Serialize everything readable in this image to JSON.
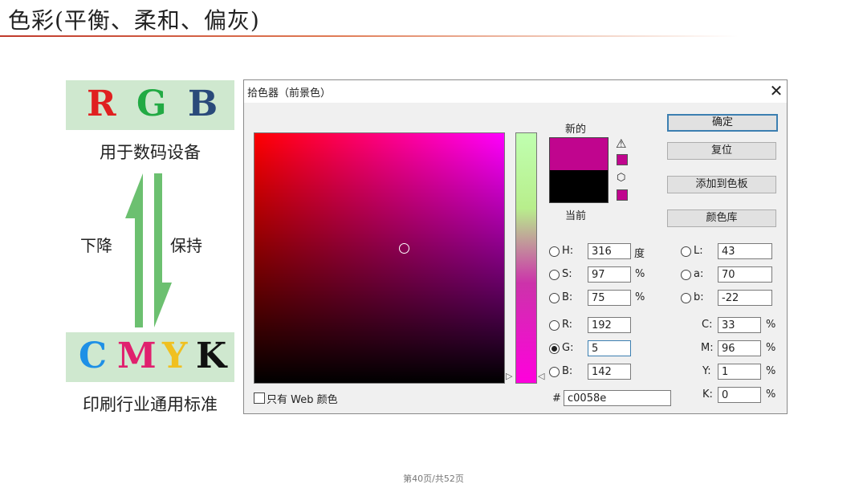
{
  "slide": {
    "title": "色彩(平衡、柔和、偏灰)",
    "footer": "第40页/共52页"
  },
  "left_panel": {
    "rgb_letters": [
      {
        "letter": "R",
        "color": "#e02020"
      },
      {
        "letter": "G",
        "color": "#22aa44"
      },
      {
        "letter": "B",
        "color": "#2a4a7a"
      }
    ],
    "rgb_caption": "用于数码设备",
    "down_label": "下降",
    "keep_label": "保持",
    "cmyk_letters": [
      {
        "letter": "C",
        "color": "#1e90e6"
      },
      {
        "letter": "M",
        "color": "#e0206e"
      },
      {
        "letter": "Y",
        "color": "#f0c020"
      },
      {
        "letter": "K",
        "color": "#111111"
      }
    ],
    "cmyk_caption": "印刷行业通用标准",
    "arrow_color": "#6cc070"
  },
  "dialog": {
    "title": "拾色器（前景色）",
    "close_glyph": "✕",
    "new_label": "新的",
    "current_label": "当前",
    "new_color": "#c0058e",
    "current_color": "#000000",
    "warning_glyph": "⚠",
    "cube_glyph": "⬡",
    "buttons": {
      "ok": "确定",
      "reset": "复位",
      "add_to_swatches": "添加到色板",
      "color_libraries": "颜色库"
    },
    "hsb": [
      {
        "label": "H:",
        "value": "316",
        "unit": "度",
        "selected": false
      },
      {
        "label": "S:",
        "value": "97",
        "unit": "%",
        "selected": false
      },
      {
        "label": "B:",
        "value": "75",
        "unit": "%",
        "selected": false
      }
    ],
    "rgb": [
      {
        "label": "R:",
        "value": "192",
        "selected": false
      },
      {
        "label": "G:",
        "value": "5",
        "selected": true
      },
      {
        "label": "B:",
        "value": "142",
        "selected": false
      }
    ],
    "lab": [
      {
        "label": "L:",
        "value": "43"
      },
      {
        "label": "a:",
        "value": "70"
      },
      {
        "label": "b:",
        "value": "-22"
      }
    ],
    "cmyk": [
      {
        "label": "C:",
        "value": "33",
        "unit": "%"
      },
      {
        "label": "M:",
        "value": "96",
        "unit": "%"
      },
      {
        "label": "Y:",
        "value": "1",
        "unit": "%"
      },
      {
        "label": "K:",
        "value": "0",
        "unit": "%"
      }
    ],
    "hex_label": "#",
    "hex_value": "c0058e",
    "web_only_label": "只有 Web 颜色",
    "web_only_checked": false
  }
}
